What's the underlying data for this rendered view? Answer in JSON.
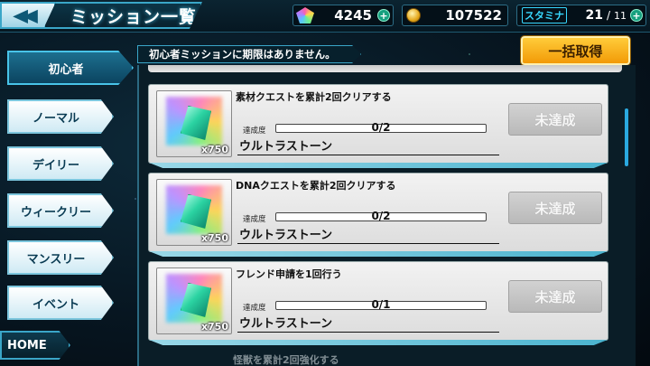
{
  "header": {
    "back_icon": "double-chevron-left-icon",
    "title": "ミッション一覧",
    "gems": "4245",
    "coins": "107522",
    "stamina_label": "スタミナ",
    "stamina_current": "21",
    "stamina_separator": "/",
    "stamina_max": "11",
    "plus_symbol": "+"
  },
  "notice": "初心者ミッションに期限はありません。",
  "bulk_button": "一括取得",
  "tabs": [
    {
      "label": "初心者",
      "active": true
    },
    {
      "label": "ノーマル",
      "active": false
    },
    {
      "label": "デイリー",
      "active": false
    },
    {
      "label": "ウィークリー",
      "active": false
    },
    {
      "label": "マンスリー",
      "active": false
    },
    {
      "label": "イベント",
      "active": false
    }
  ],
  "home_button": "HOME",
  "missions": [
    {
      "title": "素材クエストを累計2回クリアする",
      "progress_label": "達成度",
      "progress_text": "0/2",
      "progress": 0,
      "reward": "ウルトラストーン",
      "quantity": "x750",
      "status": "未達成"
    },
    {
      "title": "DNAクエストを累計2回クリアする",
      "progress_label": "達成度",
      "progress_text": "0/2",
      "progress": 0,
      "reward": "ウルトラストーン",
      "quantity": "x750",
      "status": "未達成"
    },
    {
      "title": "フレンド申請を1回行う",
      "progress_label": "達成度",
      "progress_text": "0/1",
      "progress": 0,
      "reward": "ウルトラストーン",
      "quantity": "x750",
      "status": "未達成"
    }
  ],
  "partial_next_title": "怪獣を累計2回強化する",
  "colors": {
    "accent": "#3aa6c8",
    "bulk": "#f5a910",
    "stamina_text": "#38d8ff"
  }
}
